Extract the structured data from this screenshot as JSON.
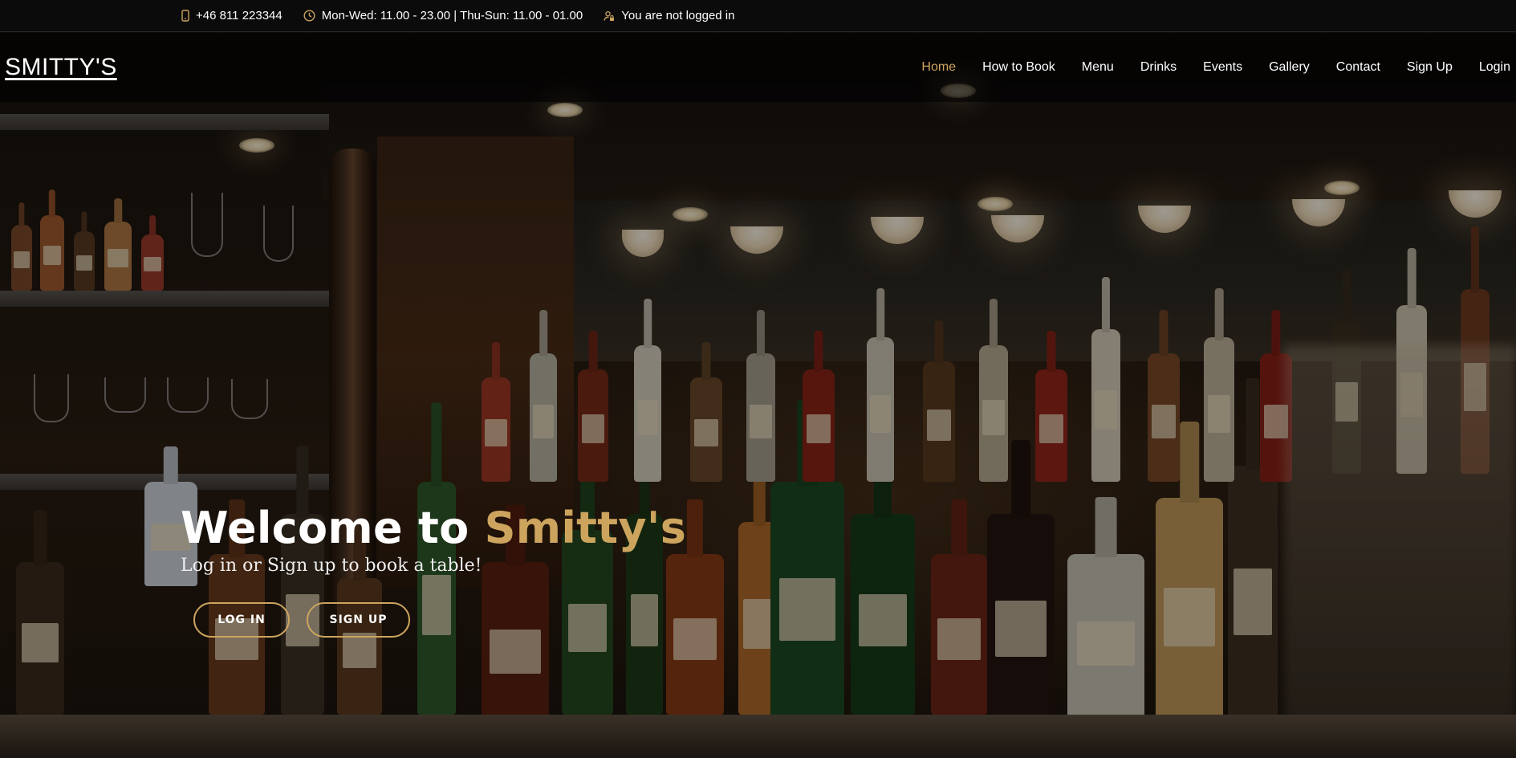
{
  "topbar": {
    "phone": "+46 811 223344",
    "hours": "Mon-Wed: 11.00 - 23.00 | Thu-Sun: 11.00 - 01.00",
    "login_status": "You are not logged in"
  },
  "navbar": {
    "logo": "SMITTY'S",
    "links": [
      "Home",
      "How to Book",
      "Menu",
      "Drinks",
      "Events",
      "Gallery",
      "Contact",
      "Sign Up",
      "Login"
    ],
    "active": "Home"
  },
  "hero": {
    "title_prefix": "Welcome to ",
    "title_brand": "Smitty's",
    "subtitle": "Log in or Sign up to book a table!",
    "login_button": "LOG IN",
    "signup_button": "SIGN UP"
  },
  "colors": {
    "accent": "#cda45e",
    "topbar_bg": "#0b0b0b",
    "text": "#ffffff"
  },
  "icons": {
    "phone": "mobile-phone-icon",
    "hours": "clock-icon",
    "status": "user-lock-icon"
  }
}
